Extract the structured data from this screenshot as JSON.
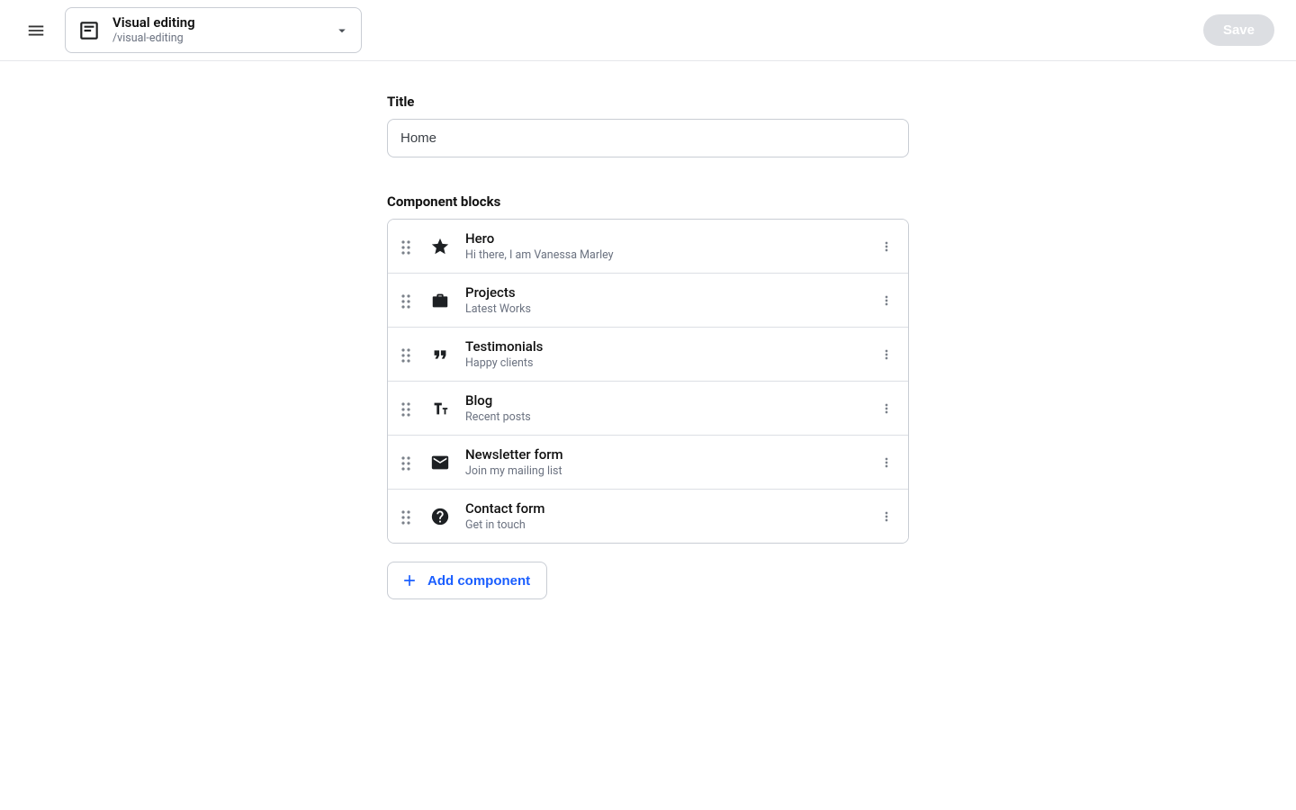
{
  "header": {
    "page_title": "Visual editing",
    "page_slug": "/visual-editing",
    "save_label": "Save"
  },
  "form": {
    "title_label": "Title",
    "title_value": "Home",
    "blocks_label": "Component blocks",
    "add_label": "Add component"
  },
  "blocks": [
    {
      "icon": "star-icon",
      "title": "Hero",
      "subtitle": "Hi there, I am Vanessa Marley"
    },
    {
      "icon": "briefcase-icon",
      "title": "Projects",
      "subtitle": "Latest Works"
    },
    {
      "icon": "quote-icon",
      "title": "Testimonials",
      "subtitle": "Happy clients"
    },
    {
      "icon": "text-icon",
      "title": "Blog",
      "subtitle": "Recent posts"
    },
    {
      "icon": "mail-icon",
      "title": "Newsletter form",
      "subtitle": "Join my mailing list"
    },
    {
      "icon": "help-icon",
      "title": "Contact form",
      "subtitle": "Get in touch"
    }
  ]
}
